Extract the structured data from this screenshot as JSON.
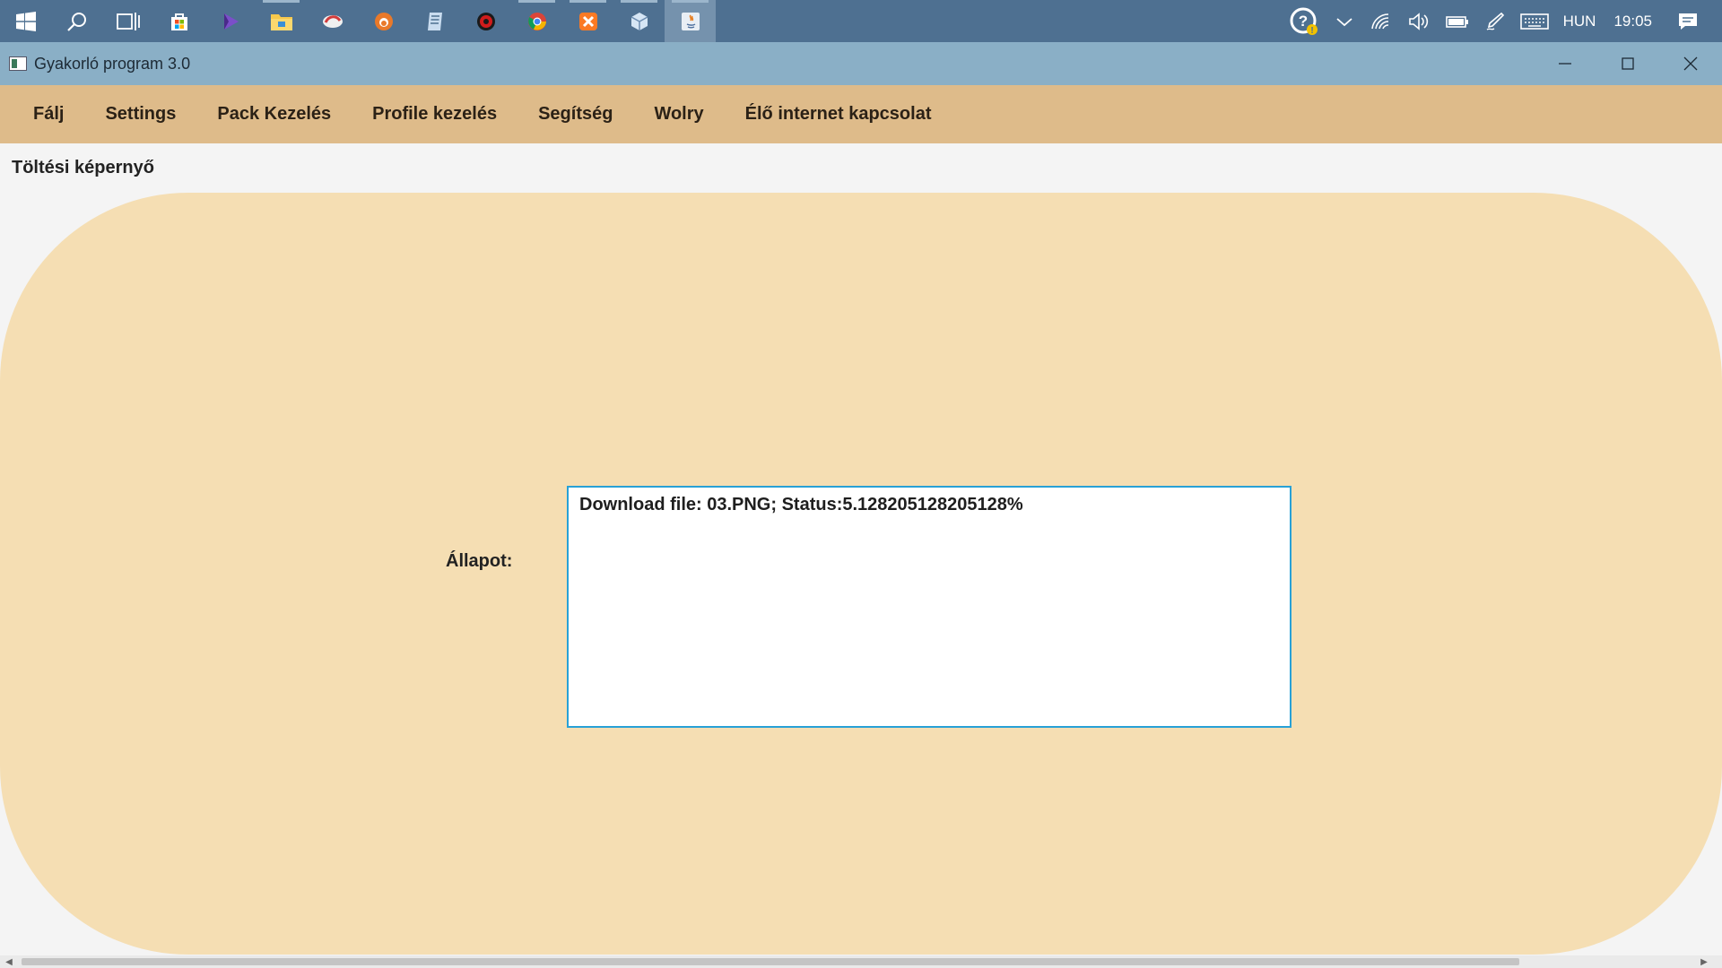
{
  "taskbar": {
    "apps": [
      {
        "name": "start-icon"
      },
      {
        "name": "search-icon"
      },
      {
        "name": "task-view-icon"
      },
      {
        "name": "store-icon"
      },
      {
        "name": "visual-studio-icon"
      },
      {
        "name": "file-explorer-icon"
      },
      {
        "name": "app-swirl-icon"
      },
      {
        "name": "app-orange-circle-icon"
      },
      {
        "name": "app-notes-icon"
      },
      {
        "name": "app-red-circle-icon"
      },
      {
        "name": "chrome-icon"
      },
      {
        "name": "xampp-icon"
      },
      {
        "name": "app-cube-icon"
      },
      {
        "name": "java-app-icon"
      }
    ],
    "tray": {
      "language": "HUN",
      "time": "19:05"
    }
  },
  "window": {
    "title": "Gyakorló program 3.0"
  },
  "menu": {
    "items": [
      "Fálj",
      "Settings",
      "Pack Kezelés",
      "Profile kezelés",
      "Segítség",
      "Wolry",
      "Élő internet kapcsolat"
    ]
  },
  "content": {
    "section_title": "Töltési képernyő",
    "status_label": "Állapot:",
    "status_text": "Download file: 03.PNG; Status:5.128205128205128%"
  },
  "colors": {
    "taskbar": "#4e7091",
    "titlebar": "#8aafc6",
    "menubar": "#debb8a",
    "panel": "#f5deb3",
    "focus_border": "#28a1d6"
  }
}
